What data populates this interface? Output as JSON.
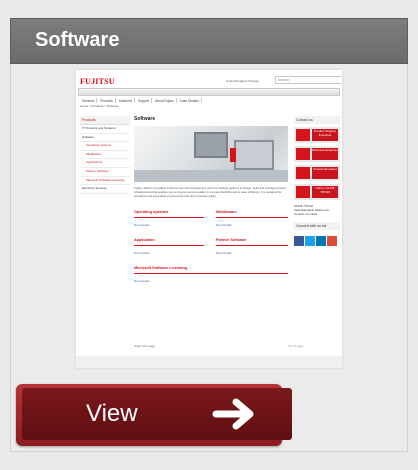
{
  "card": {
    "title": "Software"
  },
  "thumbnail": {
    "logo": "FUJITSU",
    "toplinks": "United Kingdom  Change",
    "search_placeholder": "Search",
    "nav": [
      "Services",
      "Products",
      "Solutions",
      "Support",
      "About Fujitsu",
      "Case Studies"
    ],
    "breadcrumb": "Home > Products > Software",
    "sidebar": {
      "heading": "Products",
      "items": [
        {
          "label": "IT Products and Systems",
          "sub": false
        },
        {
          "label": "Software",
          "sub": false
        },
        {
          "label": "Operating systems",
          "sub": true
        },
        {
          "label": "Middleware",
          "sub": true
        },
        {
          "label": "Applications",
          "sub": true
        },
        {
          "label": "Partner Software",
          "sub": true
        },
        {
          "label": "Microsoft Software Licensing",
          "sub": true
        },
        {
          "label": "Electronic Devices",
          "sub": false
        }
      ]
    },
    "main": {
      "heading": "Software",
      "intro": "Fujitsu delivers innovative software from own development and from leading partners to design, build and manage dynamic infrastructures that enables you to improve service quality, to increase flexibility and to raise efficiency. It is designed for virtualized and automated environments that drive business agility.",
      "sections": [
        {
          "title": "Operating systems",
          "more": "More Details"
        },
        {
          "title": "Middleware",
          "more": "More Details"
        },
        {
          "title": "Application",
          "more": "More Details"
        },
        {
          "title": "Partner Software",
          "more": "More Details"
        },
        {
          "title": "Microsoft Software Licensing",
          "more": "More Details"
        }
      ]
    },
    "right": {
      "heading": "Contact us",
      "buttons": [
        "Product Support Enquiries",
        "Business Enquiries",
        "Careers Enquiries",
        "Call us: 01235 797110"
      ],
      "phone": "01235 797110",
      "email": "AskFujitsu@uk.fujitsu.com",
      "contact_online": "Contact us online",
      "connect": "Connect with us via"
    },
    "share": "Share this page",
    "top": "Top of page"
  },
  "view_button": {
    "label": "View"
  },
  "colors": {
    "accent": "#d7141c",
    "header_bg": "#757575",
    "button_bg": "#7c181c"
  }
}
